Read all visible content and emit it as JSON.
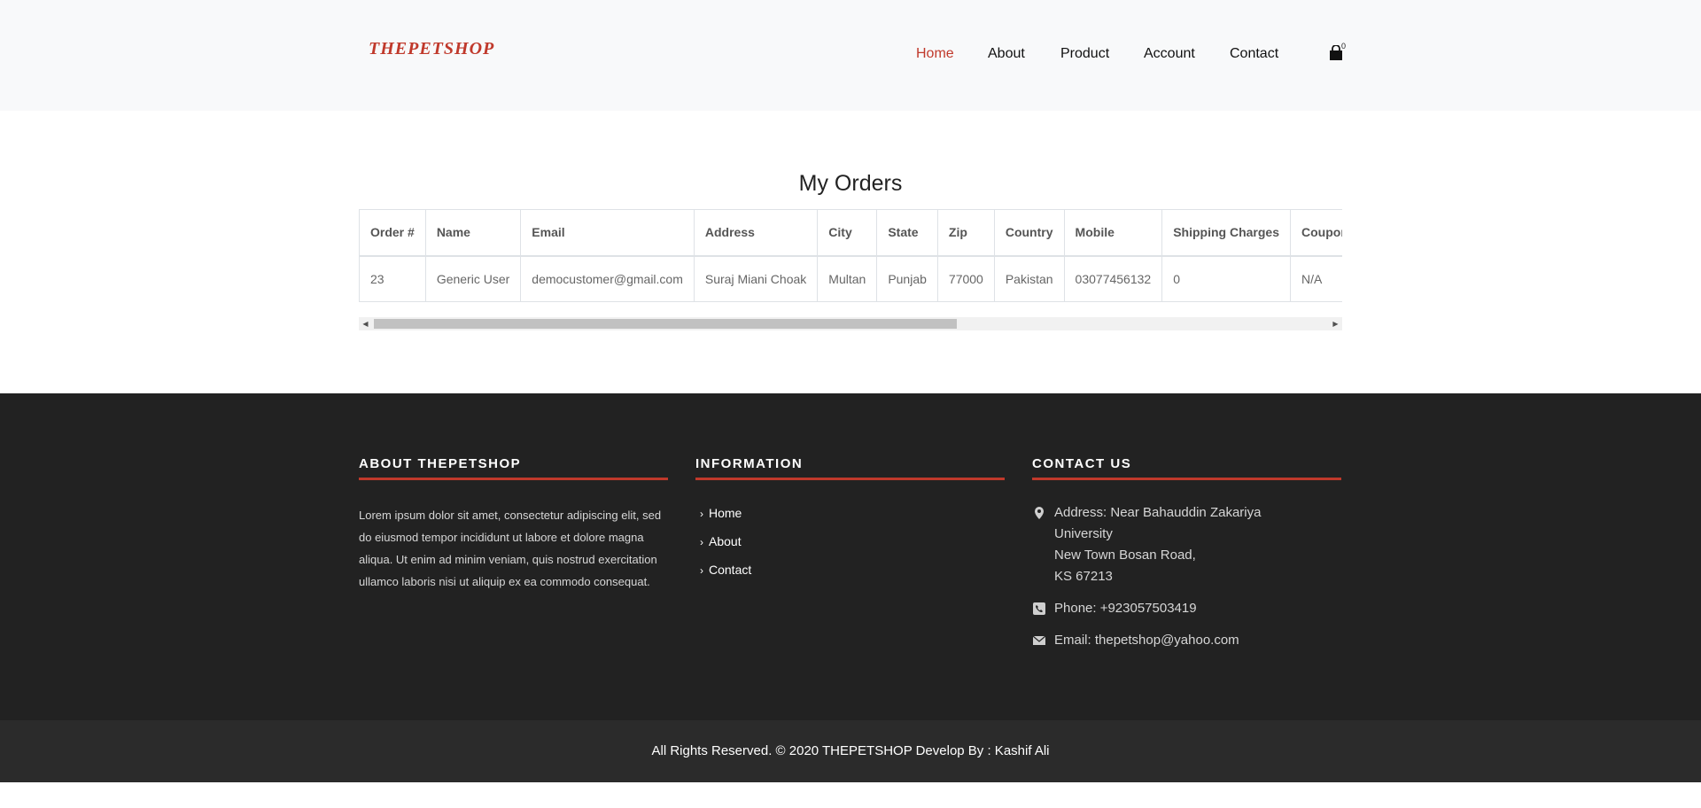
{
  "header": {
    "logo": "THEPETSHOP",
    "nav": [
      {
        "label": "Home",
        "active": true
      },
      {
        "label": "About",
        "active": false
      },
      {
        "label": "Product",
        "active": false
      },
      {
        "label": "Account",
        "active": false
      },
      {
        "label": "Contact",
        "active": false
      }
    ],
    "cart_icon": "shopping-bag-icon",
    "cart_count": "0"
  },
  "orders": {
    "title": "My Orders",
    "columns": [
      "Order #",
      "Name",
      "Email",
      "Address",
      "City",
      "State",
      "Zip",
      "Country",
      "Mobile",
      "Shipping Charges",
      "Coupon"
    ],
    "rows": [
      [
        "23",
        "Generic User",
        "democustomer@gmail.com",
        "Suraj Miani Choak",
        "Multan",
        "Punjab",
        "77000",
        "Pakistan",
        "03077456132",
        "0",
        "N/A"
      ]
    ]
  },
  "footer": {
    "about": {
      "heading": "ABOUT THEPETSHOP",
      "text": "Lorem ipsum dolor sit amet, consectetur adipiscing elit, sed do eiusmod tempor incididunt ut labore et dolore magna aliqua. Ut enim ad minim veniam, quis nostrud exercitation ullamco laboris nisi ut aliquip ex ea commodo consequat."
    },
    "information": {
      "heading": "INFORMATION",
      "links": [
        "Home",
        "About",
        "Contact"
      ]
    },
    "contact": {
      "heading": "CONTACT US",
      "address_lines": [
        "Address: Near Bahauddin Zakariya",
        "University",
        "New Town Bosan Road,",
        "KS 67213"
      ],
      "phone": "Phone: +923057503419",
      "email": "Email: thepetshop@yahoo.com"
    },
    "copyright": "All Rights Reserved. © 2020 THEPETSHOP Develop By : Kashif Ali"
  },
  "colors": {
    "accent": "#c0392b",
    "header_bg": "#f8f9fa",
    "footer_bg": "#222222",
    "bottom_bar_bg": "#2b2b2b"
  }
}
